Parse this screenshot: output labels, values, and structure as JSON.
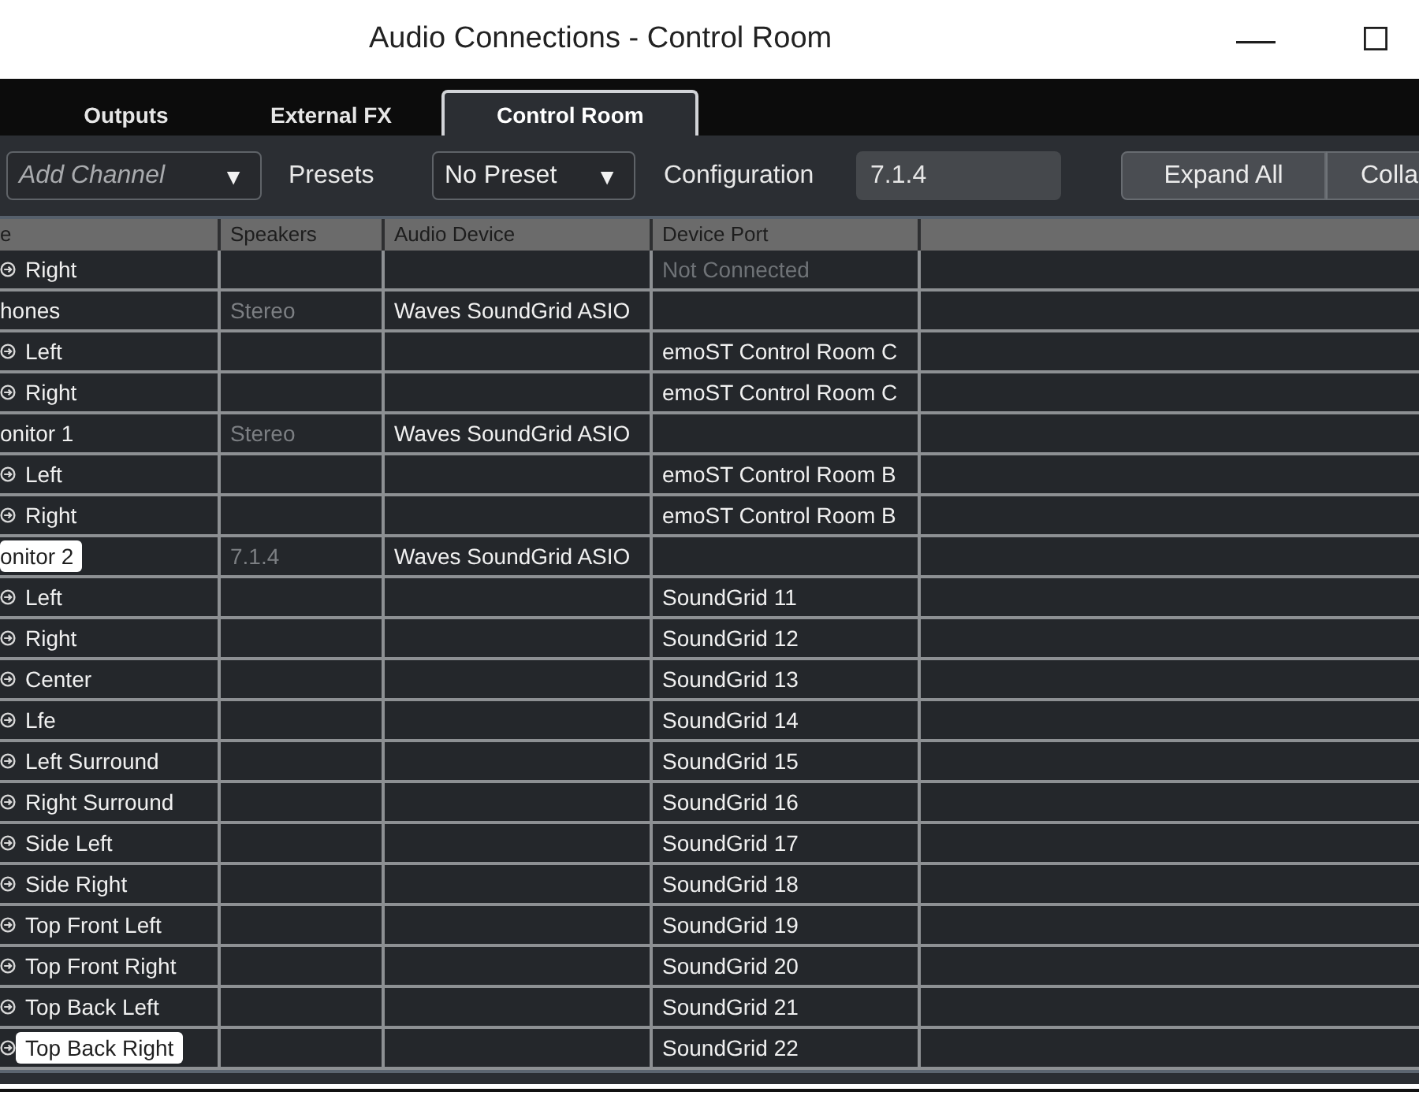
{
  "window": {
    "title": "Audio Connections - Control Room"
  },
  "tabs": [
    {
      "label": "Outputs",
      "selected": false
    },
    {
      "label": "External FX",
      "selected": false
    },
    {
      "label": "Control Room",
      "selected": true
    }
  ],
  "toolbar": {
    "add_channel": {
      "placeholder": "Add Channel",
      "arrow": "▼"
    },
    "presets_label": "Presets",
    "preset": {
      "value": "No Preset",
      "arrow": "▼"
    },
    "configuration_label": "Configuration",
    "configuration": {
      "value": "7.1.4"
    },
    "buttons": [
      "Expand All",
      "Colla"
    ]
  },
  "table": {
    "columns": [
      "e",
      "Speakers",
      "Audio Device",
      "Device Port"
    ],
    "rows": [
      {
        "kind": "channel",
        "name": "Right",
        "port": "Not Connected",
        "connected": false,
        "selected": false
      },
      {
        "kind": "bus",
        "name": "hones",
        "speakers": "Stereo",
        "device": "Waves SoundGrid ASIO",
        "selected": false
      },
      {
        "kind": "channel",
        "name": "Left",
        "port": "emoST Control Room C",
        "connected": true,
        "selected": false
      },
      {
        "kind": "channel",
        "name": "Right",
        "port": "emoST Control Room C",
        "connected": true,
        "selected": false
      },
      {
        "kind": "bus",
        "name": "onitor 1",
        "speakers": "Stereo",
        "device": "Waves SoundGrid ASIO",
        "selected": false
      },
      {
        "kind": "channel",
        "name": "Left",
        "port": "emoST Control Room B",
        "connected": true,
        "selected": false
      },
      {
        "kind": "channel",
        "name": "Right",
        "port": "emoST Control Room B",
        "connected": true,
        "selected": false
      },
      {
        "kind": "bus",
        "name": "onitor 2",
        "speakers": "7.1.4",
        "device": "Waves SoundGrid ASIO",
        "selected": true
      },
      {
        "kind": "channel",
        "name": "Left",
        "port": "SoundGrid 11",
        "connected": true,
        "selected": false
      },
      {
        "kind": "channel",
        "name": "Right",
        "port": "SoundGrid 12",
        "connected": true,
        "selected": false
      },
      {
        "kind": "channel",
        "name": "Center",
        "port": "SoundGrid 13",
        "connected": true,
        "selected": false
      },
      {
        "kind": "channel",
        "name": "Lfe",
        "port": "SoundGrid 14",
        "connected": true,
        "selected": false
      },
      {
        "kind": "channel",
        "name": "Left Surround",
        "port": "SoundGrid 15",
        "connected": true,
        "selected": false
      },
      {
        "kind": "channel",
        "name": "Right Surround",
        "port": "SoundGrid 16",
        "connected": true,
        "selected": false
      },
      {
        "kind": "channel",
        "name": "Side Left",
        "port": "SoundGrid 17",
        "connected": true,
        "selected": false
      },
      {
        "kind": "channel",
        "name": "Side Right",
        "port": "SoundGrid 18",
        "connected": true,
        "selected": false
      },
      {
        "kind": "channel",
        "name": "Top Front Left",
        "port": "SoundGrid 19",
        "connected": true,
        "selected": false
      },
      {
        "kind": "channel",
        "name": "Top Front Right",
        "port": "SoundGrid 20",
        "connected": true,
        "selected": false
      },
      {
        "kind": "channel",
        "name": "Top Back Left",
        "port": "SoundGrid 21",
        "connected": true,
        "selected": false
      },
      {
        "kind": "channel",
        "name": "Top Back Right",
        "port": "SoundGrid 22",
        "connected": true,
        "selected": true
      }
    ]
  }
}
